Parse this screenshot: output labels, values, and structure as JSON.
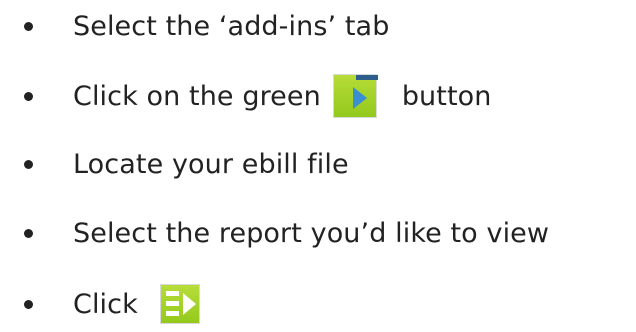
{
  "steps": [
    {
      "text": "Select the ‘add-ins’ tab"
    },
    {
      "text_before": "Click on the green",
      "icon": "green-play-button-icon",
      "text_after": "button"
    },
    {
      "text": "Locate your ebill file"
    },
    {
      "text": "Select the report you’d like to view"
    },
    {
      "text_before": "Click",
      "icon": "green-list-arrow-icon"
    }
  ],
  "colors": {
    "text": "#222222",
    "icon_green": "#a3d12a",
    "icon_blue": "#3a8fd2",
    "icon_navy": "#2e5f8a"
  }
}
